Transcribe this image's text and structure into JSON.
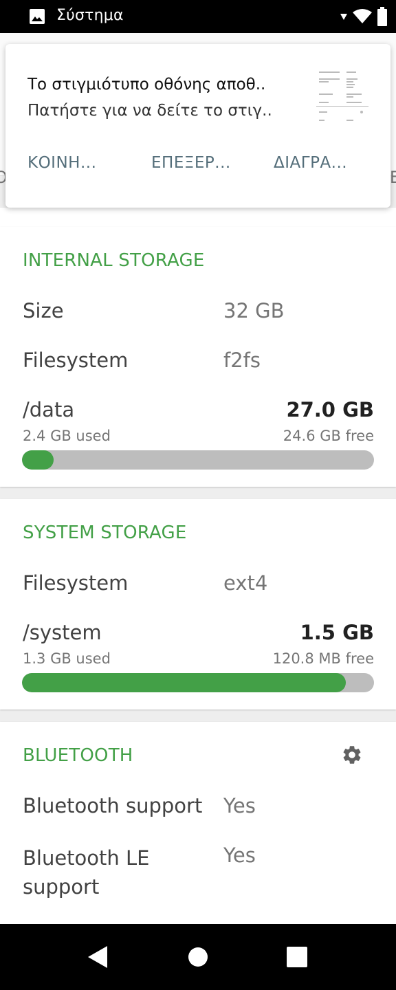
{
  "status_bar": {
    "title": "Σύστημα",
    "icons": [
      "image-icon",
      "signal-arrow-icon",
      "wifi-icon",
      "battery-icon"
    ]
  },
  "tab_strip": {
    "left_peek": "O",
    "right_peek": "E"
  },
  "notification": {
    "title": "Το στιγμιότυπο οθόνης αποθ..",
    "text": "Πατήστε για να δείτε το στιγ..",
    "actions": [
      "ΚΟΙΝΗ...",
      "ΕΠΕΞΕΡ...",
      "ΔΙΑΓΡΑ..."
    ]
  },
  "internal_storage": {
    "header": "INTERNAL STORAGE",
    "rows": [
      {
        "label": "Size",
        "value": "32 GB"
      },
      {
        "label": "Filesystem",
        "value": "f2fs"
      }
    ],
    "mount": {
      "name": "/data",
      "total": "27.0 GB",
      "used": "2.4 GB used",
      "free": "24.6 GB free",
      "used_fraction": 0.09
    }
  },
  "system_storage": {
    "header": "SYSTEM STORAGE",
    "rows": [
      {
        "label": "Filesystem",
        "value": "ext4"
      }
    ],
    "mount": {
      "name": "/system",
      "total": "1.5 GB",
      "used": "1.3 GB used",
      "free": "120.8 MB free",
      "used_fraction": 0.92
    }
  },
  "bluetooth": {
    "header": "BLUETOOTH",
    "settings_icon": "gear-icon",
    "rows": [
      {
        "label": "Bluetooth support",
        "value": "Yes"
      },
      {
        "label": "Bluetooth LE support",
        "value": "Yes"
      }
    ]
  },
  "nav_bar": {
    "buttons": [
      "back-icon",
      "home-icon",
      "recents-icon"
    ]
  },
  "colors": {
    "accent": "#43a047",
    "action": "#546e7a",
    "track": "#bdbdbd"
  }
}
